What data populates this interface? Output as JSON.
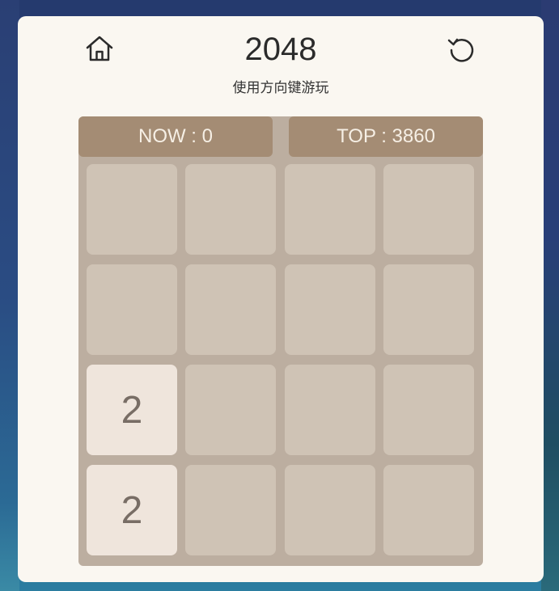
{
  "header": {
    "title": "2048",
    "subtitle": "使用方向键游玩",
    "home_icon": "home-icon",
    "reset_icon": "reset-icon"
  },
  "scores": {
    "now_label": "NOW : 0",
    "top_label": "TOP : 3860"
  },
  "grid": [
    [
      "",
      "",
      "",
      ""
    ],
    [
      "",
      "",
      "",
      ""
    ],
    [
      "2",
      "",
      "",
      ""
    ],
    [
      "2",
      "",
      "",
      ""
    ]
  ],
  "colors": {
    "panel": "#faf7f1",
    "board": "#bcaea0",
    "score_bar": "#a48c74",
    "empty_tile": "#cfc3b5",
    "tile_2": "#efe5dc",
    "tile_text": "#786d65"
  }
}
